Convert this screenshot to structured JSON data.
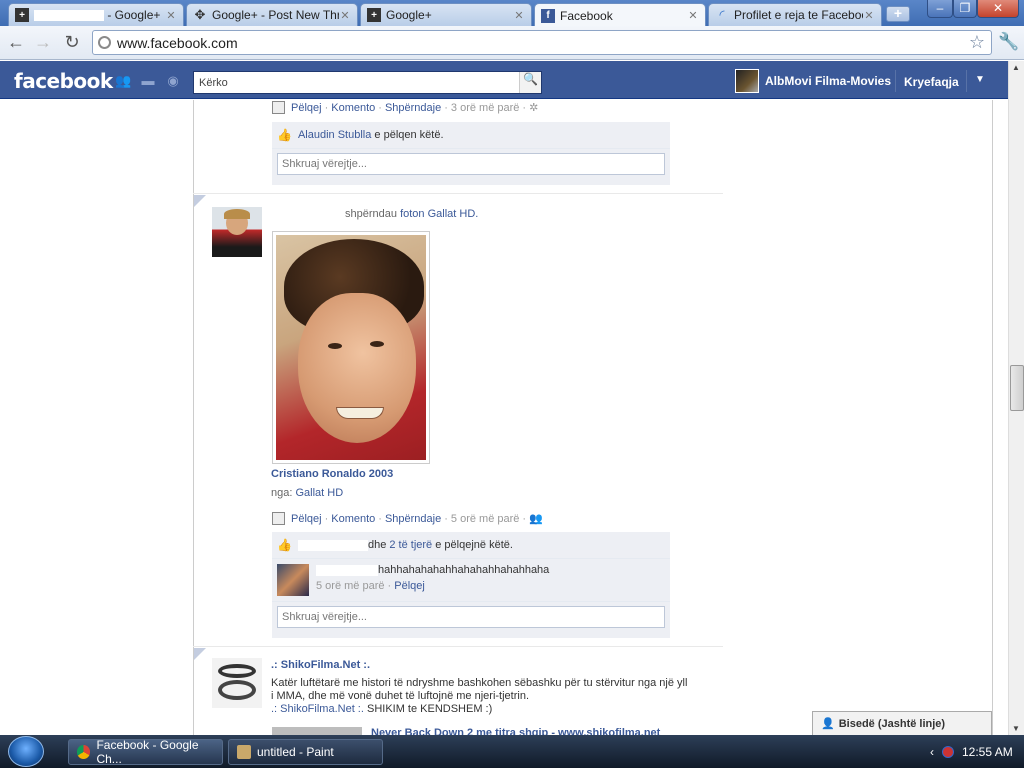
{
  "browser": {
    "tabs": [
      {
        "title": "- Google+",
        "icon": "google-plus-icon",
        "active": false
      },
      {
        "title": "Google+ - Post New Threa",
        "icon": "google-plus-icon",
        "active": false
      },
      {
        "title": "Google+",
        "icon": "google-plus-icon",
        "active": false
      },
      {
        "title": "Facebook",
        "icon": "facebook-icon",
        "active": true
      },
      {
        "title": "Profilet e reja te Facebool",
        "icon": "loading-icon",
        "active": false
      }
    ],
    "url": "www.facebook.com"
  },
  "fb": {
    "logo": "facebook",
    "search_placeholder": "Kërko",
    "profile_name": "AlbMovi Filma-Movies",
    "home_label": "Kryefaqja"
  },
  "post0": {
    "actions": [
      "Pëlqej",
      "Komento",
      "Shpërndaje"
    ],
    "time": "3 orë më parë",
    "like_user": "Alaudin Stublla",
    "like_suffix": "e pëlqen këtë.",
    "comment_placeholder": "Shkruaj vërejtje..."
  },
  "post1": {
    "shared_text": "shpërndau",
    "photo_link": "foton",
    "page_link": "Gallat HD.",
    "photo_title": "Cristiano Ronaldo 2003",
    "from_label": "nga:",
    "from_page": "Gallat HD",
    "actions": [
      "Pëlqej",
      "Komento",
      "Shpërndaje"
    ],
    "time": "5 orë më parë",
    "likes_and": "dhe",
    "likes_others": "2 të tjerë",
    "likes_suffix": "e pëlqejnë këtë.",
    "comment_text": "hahhahahahahhahahahhahahhaha",
    "comment_time": "5 orë më parë",
    "comment_like": "Pëlqej",
    "comment_placeholder": "Shkruaj vërejtje..."
  },
  "post2": {
    "author": ".: ShikoFilma.Net :.",
    "text_line1": "Katër luftëtarë me histori të ndryshme bashkohen sëbashku për tu stërvitur nga një yll",
    "text_line2": "i MMA, dhe më vonë duhet të luftojnë me njeri-tjetrin.",
    "text_link": ".: ShikoFilma.Net :.",
    "text_tail": "SHIKIM te KENDSHEM :)",
    "next_link": "Never Back Down 2 me titra shqip - www.shikofilma.net"
  },
  "chat_label": "Bisedë (Jashtë linje)",
  "taskbar": {
    "items": [
      "Facebook - Google Ch...",
      "untitled - Paint"
    ],
    "clock": "12:55 AM"
  }
}
